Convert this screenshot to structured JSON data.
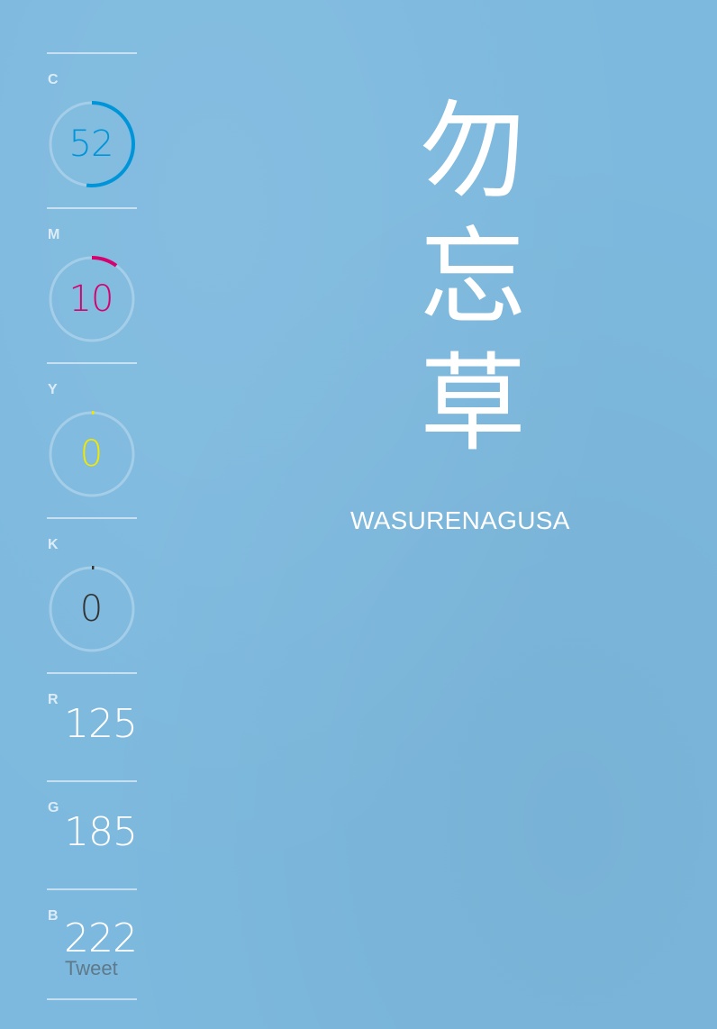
{
  "color": {
    "name_jp": [
      "勿",
      "忘",
      "草"
    ],
    "name_romaji": "WASURENAGUSA",
    "background_hex": "#7DB9DE"
  },
  "cmyk": [
    {
      "label": "C",
      "value": "52",
      "accent": "#0095D9"
    },
    {
      "label": "M",
      "value": "10",
      "accent": "#D7006F"
    },
    {
      "label": "Y",
      "value": "0",
      "accent": "#F0E800"
    },
    {
      "label": "K",
      "value": "0",
      "accent": "#333333"
    }
  ],
  "rgb": [
    {
      "label": "R",
      "value": "125"
    },
    {
      "label": "G",
      "value": "185"
    },
    {
      "label": "B",
      "value": "222"
    }
  ],
  "share": {
    "tweet_label": "Tweet"
  }
}
